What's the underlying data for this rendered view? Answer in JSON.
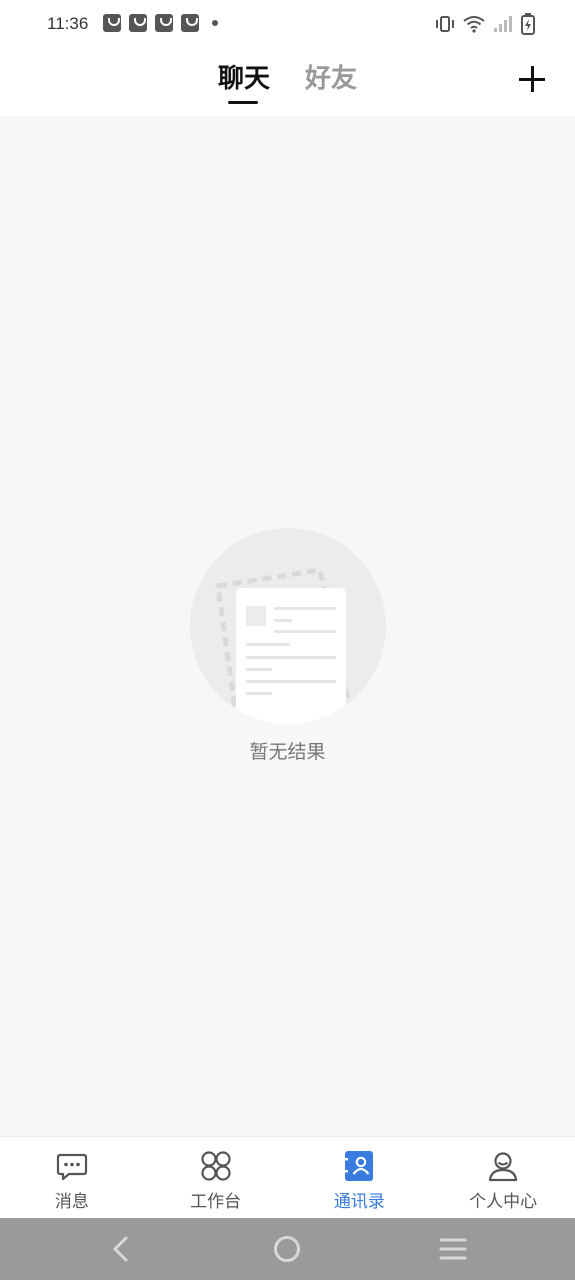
{
  "status_bar": {
    "time": "11:36"
  },
  "header": {
    "tabs": [
      {
        "label": "聊天",
        "active": true
      },
      {
        "label": "好友",
        "active": false
      }
    ]
  },
  "empty_state": {
    "message": "暂无结果"
  },
  "bottom_nav": {
    "items": [
      {
        "label": "消息",
        "icon": "message-icon"
      },
      {
        "label": "工作台",
        "icon": "workbench-icon"
      },
      {
        "label": "通讯录",
        "icon": "contacts-icon",
        "active": true
      },
      {
        "label": "个人中心",
        "icon": "profile-icon"
      }
    ]
  },
  "colors": {
    "accent": "#3a7be0",
    "background": "#f7f7f7",
    "system_nav": "#9a9a9a"
  }
}
